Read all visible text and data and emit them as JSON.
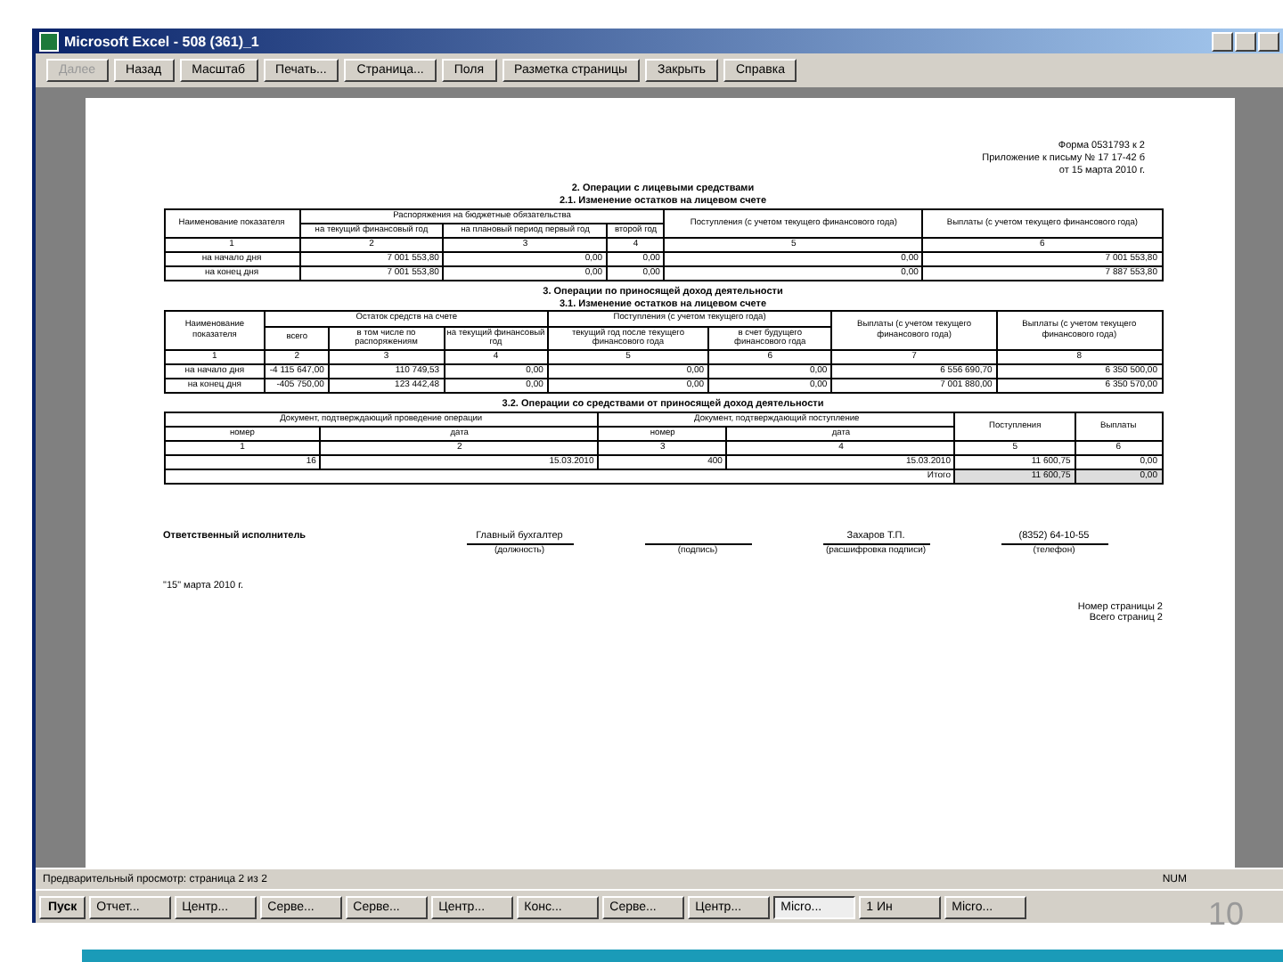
{
  "window": {
    "title": "Microsoft Excel - 508 (361)_1"
  },
  "toolbar": [
    {
      "label": "Далее",
      "disabled": true
    },
    {
      "label": "Назад",
      "disabled": false
    },
    {
      "label": "Масштаб",
      "disabled": false
    },
    {
      "label": "Печать...",
      "disabled": false
    },
    {
      "label": "Страница...",
      "disabled": false
    },
    {
      "label": "Поля",
      "disabled": false
    },
    {
      "label": "Разметка страницы",
      "disabled": false
    },
    {
      "label": "Закрыть",
      "disabled": false
    },
    {
      "label": "Справка",
      "disabled": false
    }
  ],
  "sheet": {
    "header_lines": [
      "Форма 0531793 к 2",
      "Приложение к письму № 17 17-42 б",
      "от 15 марта 2010 г."
    ],
    "sections": [
      {
        "titles": [
          "2. Операции с лицевыми средствами",
          "2.1. Изменение остатков на лицевом счете"
        ],
        "header_rows": [
          [
            {
              "text": "Наименование показателя",
              "rowspan": 2
            },
            {
              "text": "Распоряжения на бюджетные обязательства",
              "colspan": 3
            },
            {
              "text": "Поступления (с учетом текущего финансового года)",
              "rowspan": 2
            },
            {
              "text": "Выплаты (с учетом текущего финансового года)",
              "rowspan": 2
            }
          ],
          [
            {
              "text": "на текущий финансовый год"
            },
            {
              "text": "на плановый период первый год"
            },
            {
              "text": "второй год"
            }
          ]
        ],
        "numbers": [
          "1",
          "2",
          "3",
          "4",
          "5",
          "6"
        ],
        "rows": [
          [
            "на начало дня",
            "7 001 553,80",
            "0,00",
            "0,00",
            "0,00",
            "7 001 553,80"
          ],
          [
            "на конец дня",
            "7 001 553,80",
            "0,00",
            "0,00",
            "0,00",
            "7 887 553,80"
          ]
        ]
      },
      {
        "titles": [
          "3. Операции по приносящей доход деятельности",
          "3.1. Изменение остатков на лицевом счете"
        ],
        "header_rows": [
          [
            {
              "text": "Наименование показателя",
              "rowspan": 2
            },
            {
              "text": "Остаток средств на счете",
              "colspan": 3
            },
            {
              "text": "Поступления (с учетом текущего года)",
              "colspan": 2
            },
            {
              "text": "Выплаты (с учетом текущего финансового года)",
              "rowspan": 2
            },
            {
              "text": "Выплаты (с учетом текущего финансового года)",
              "rowspan": 2
            }
          ],
          [
            {
              "text": "всего"
            },
            {
              "text": "в том числе по распоряжениям"
            },
            {
              "text": "на текущий финансовый год"
            },
            {
              "text": "текущий год после текущего финансового года"
            },
            {
              "text": "в счет будущего финансового года"
            }
          ]
        ],
        "numbers": [
          "1",
          "2",
          "3",
          "4",
          "5",
          "6",
          "7",
          "8"
        ],
        "rows": [
          [
            "на начало дня",
            "-4 115 647,00",
            "110 749,53",
            "0,00",
            "0,00",
            "0,00",
            "6 556 690,70",
            "6 350 500,00"
          ],
          [
            "на конец дня",
            "-405 750,00",
            "123 442,48",
            "0,00",
            "0,00",
            "0,00",
            "7 001 880,00",
            "6 350 570,00"
          ]
        ]
      },
      {
        "titles": [
          "3.2. Операции со средствами от приносящей доход деятельности"
        ],
        "header_rows": [
          [
            {
              "text": "Документ, подтверждающий проведение операции",
              "colspan": 2
            },
            {
              "text": "Документ, подтверждающий поступление",
              "colspan": 2
            },
            {
              "text": "Поступления",
              "rowspan": 2
            },
            {
              "text": "Выплаты",
              "rowspan": 2
            }
          ],
          [
            {
              "text": "номер"
            },
            {
              "text": "дата"
            },
            {
              "text": "номер"
            },
            {
              "text": "дата"
            }
          ]
        ],
        "numbers": [
          "1",
          "2",
          "3",
          "4",
          "5",
          "6"
        ],
        "rows": [
          [
            "16",
            "15.03.2010",
            "400",
            "15.03.2010",
            "11 600,75",
            "0,00"
          ]
        ],
        "total": {
          "label": "Итого",
          "values": [
            "11 600,75",
            "0,00"
          ]
        }
      }
    ],
    "signature": {
      "label": "Ответственный исполнитель",
      "fields": [
        {
          "value": "Главный бухгалтер",
          "caption": "(должность)"
        },
        {
          "caption": "(подпись)"
        },
        {
          "value": "Захаров Т.П.",
          "caption": "(расшифровка подписи)"
        },
        {
          "value": "(8352) 64-10-55",
          "caption": "(телефон)"
        }
      ]
    },
    "date": "\"15\" марта 2010 г.",
    "page_lines": [
      "Номер страницы 2",
      "Всего страниц 2"
    ]
  },
  "status_bar": {
    "text": "Предварительный просмотр: страница 2 из 2",
    "indicator": "NUM"
  },
  "taskbar": {
    "start": "Пуск",
    "items": [
      {
        "label": "Отчет...",
        "selected": false
      },
      {
        "label": "Центр...",
        "selected": false
      },
      {
        "label": "Серве...",
        "selected": false
      },
      {
        "label": "Серве...",
        "selected": false
      },
      {
        "label": "Центр...",
        "selected": false
      },
      {
        "label": "Конс...",
        "selected": false
      },
      {
        "label": "Серве...",
        "selected": false
      },
      {
        "label": "Центр...",
        "selected": false
      },
      {
        "label": "Micro...",
        "selected": true
      },
      {
        "label": "1 Ин",
        "selected": false
      },
      {
        "label": "Micro...",
        "selected": false
      }
    ]
  },
  "slide_number": "10"
}
